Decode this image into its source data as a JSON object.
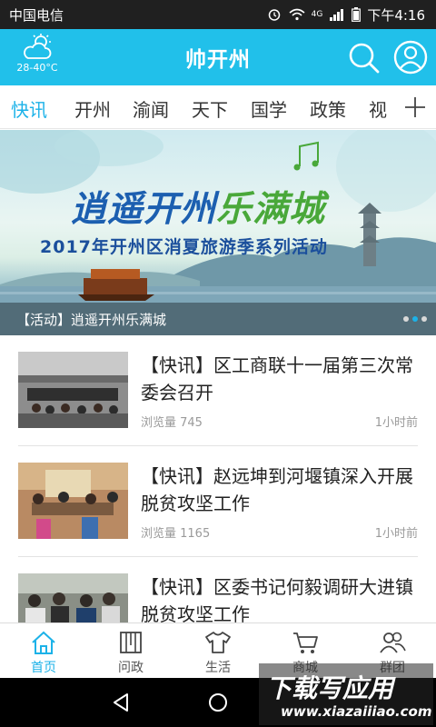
{
  "status_bar": {
    "carrier": "中国电信",
    "time": "下午4:16",
    "network": "4G"
  },
  "header": {
    "weather_icon": "cloud-sun-icon",
    "temperature": "28-40°C",
    "title": "帅开州",
    "search_icon": "search-icon",
    "user_icon": "user-icon",
    "brand_color": "#21c0ea"
  },
  "tabs": [
    {
      "label": "快讯",
      "active": true
    },
    {
      "label": "开州",
      "active": false
    },
    {
      "label": "渝闻",
      "active": false
    },
    {
      "label": "天下",
      "active": false
    },
    {
      "label": "国学",
      "active": false
    },
    {
      "label": "政策",
      "active": false
    },
    {
      "label": "视",
      "active": false
    }
  ],
  "tab_add_icon": "plus-icon",
  "banner": {
    "title_part1": "逍遥开州",
    "title_part2": "乐满城",
    "subtitle": "2017年开州区消夏旅游季系列活动",
    "caption": "【活动】逍遥开州乐满城",
    "slide_count": 3,
    "active_slide": 2
  },
  "news": [
    {
      "title": "【快讯】区工商联十一届第三次常委会召开",
      "views": "浏览量 745",
      "time": "1小时前"
    },
    {
      "title": "【快讯】赵远坤到河堰镇深入开展脱贫攻坚工作",
      "views": "浏览量 1165",
      "time": "1小时前"
    },
    {
      "title": "【快讯】区委书记何毅调研大进镇脱贫攻坚工作",
      "views": "",
      "time": ""
    }
  ],
  "bottom_nav": [
    {
      "label": "首页",
      "icon": "home-icon",
      "active": true
    },
    {
      "label": "问政",
      "icon": "book-icon",
      "active": false
    },
    {
      "label": "生活",
      "icon": "tshirt-icon",
      "active": false
    },
    {
      "label": "商城",
      "icon": "cart-icon",
      "active": false
    },
    {
      "label": "群团",
      "icon": "group-icon",
      "active": false
    }
  ],
  "watermark": {
    "main": "下载写应用",
    "url": "www.xiazaiiiao.com"
  },
  "colors": {
    "accent": "#1cb2e8",
    "header": "#21c0ea",
    "text": "#222222",
    "muted": "#9a9a9a"
  }
}
